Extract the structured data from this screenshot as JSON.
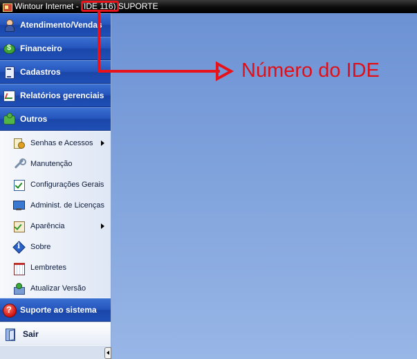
{
  "window": {
    "title_prefix": "Wintour Internet - ",
    "title_ide": "(IDE 116)",
    "title_suffix": " SUPORTE"
  },
  "sidebar": {
    "sections": [
      {
        "label": "Atendimento/Vendas",
        "icon": "user-icon"
      },
      {
        "label": "Financeiro",
        "icon": "money-icon"
      },
      {
        "label": "Cadastros",
        "icon": "cadastro-icon"
      },
      {
        "label": "Relatórios gerenciais",
        "icon": "chart-icon"
      },
      {
        "label": "Outros",
        "icon": "puzzle-icon"
      }
    ],
    "outros_items": [
      {
        "label": "Senhas e Acessos",
        "icon": "key-icon",
        "has_submenu": true
      },
      {
        "label": "Manutenção",
        "icon": "wrench-icon",
        "has_submenu": false
      },
      {
        "label": "Configurações Gerais",
        "icon": "checklist-icon",
        "has_submenu": false
      },
      {
        "label": "Administ. de Licenças",
        "icon": "monitor-icon",
        "has_submenu": false
      },
      {
        "label": "Aparência",
        "icon": "appearance-icon",
        "has_submenu": true
      },
      {
        "label": "Sobre",
        "icon": "info-icon",
        "has_submenu": false
      },
      {
        "label": "Lembretes",
        "icon": "calendar-icon",
        "has_submenu": false
      },
      {
        "label": "Atualizar Versão",
        "icon": "update-icon",
        "has_submenu": false
      }
    ],
    "support": {
      "label": "Suporte ao sistema",
      "icon": "help-icon"
    },
    "exit": {
      "label": "Sair",
      "icon": "exit-icon"
    }
  },
  "annotation": {
    "text": "Número do IDE",
    "color": "#e8121a"
  }
}
